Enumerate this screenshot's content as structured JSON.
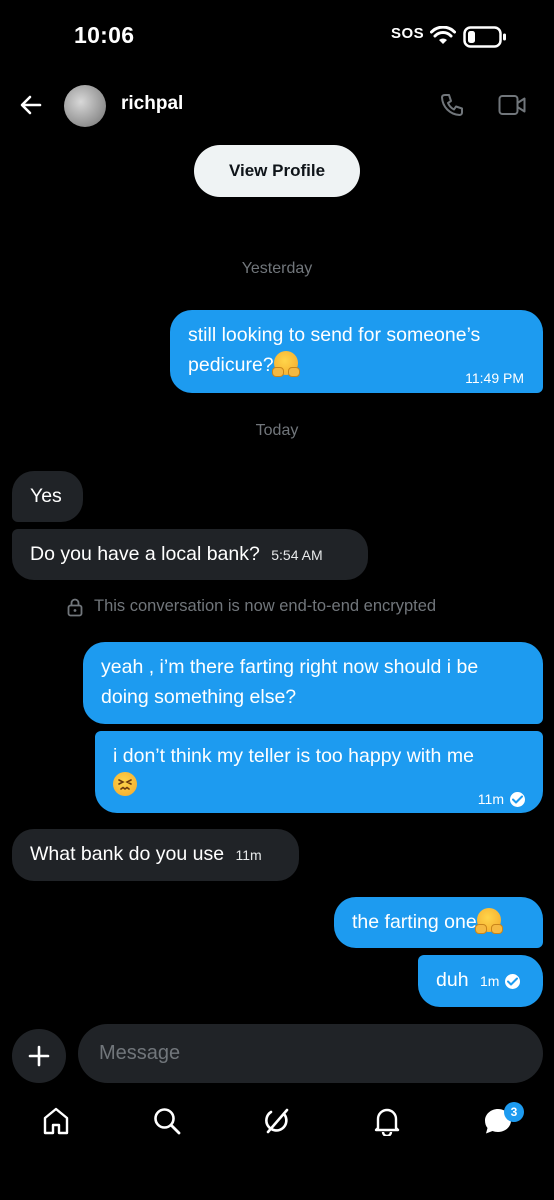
{
  "status_bar": {
    "time": "10:06",
    "sos": "SOS"
  },
  "header": {
    "username": "richpal",
    "view_profile": "View Profile"
  },
  "dates": {
    "yesterday": "Yesterday",
    "today": "Today"
  },
  "messages": [
    {
      "dir": "out",
      "line1": "still looking to send for someone’s",
      "line2": "pedicure?",
      "emoji": "hugging-face",
      "time": "11:49 PM"
    },
    {
      "dir": "in",
      "text": "Yes"
    },
    {
      "dir": "in",
      "text": "Do you have a local bank?",
      "time": "5:54 AM"
    },
    {
      "dir": "out",
      "line1": "yeah , i’m there farting right now should i be",
      "line2": "doing something else?"
    },
    {
      "dir": "out",
      "line1": "i don’t think my teller is too happy with me",
      "emoji": "persevering-face",
      "time": "11m",
      "status": "read"
    },
    {
      "dir": "in",
      "text": "What bank do you use",
      "time": "11m"
    },
    {
      "dir": "out",
      "text": "the farting one",
      "emoji": "hugging-face"
    },
    {
      "dir": "out",
      "text": "duh",
      "time": "1m",
      "status": "read"
    }
  ],
  "encryption_notice": "This conversation is now end-to-end encrypted",
  "composer": {
    "placeholder": "Message"
  },
  "nav": {
    "items": [
      "home-icon",
      "search-icon",
      "grok-icon",
      "notifications-icon",
      "messages-icon"
    ],
    "messages_badge": "3"
  },
  "colors": {
    "accent": "#1d9bf0",
    "incoming_bubble": "#202327",
    "background": "#000000"
  }
}
